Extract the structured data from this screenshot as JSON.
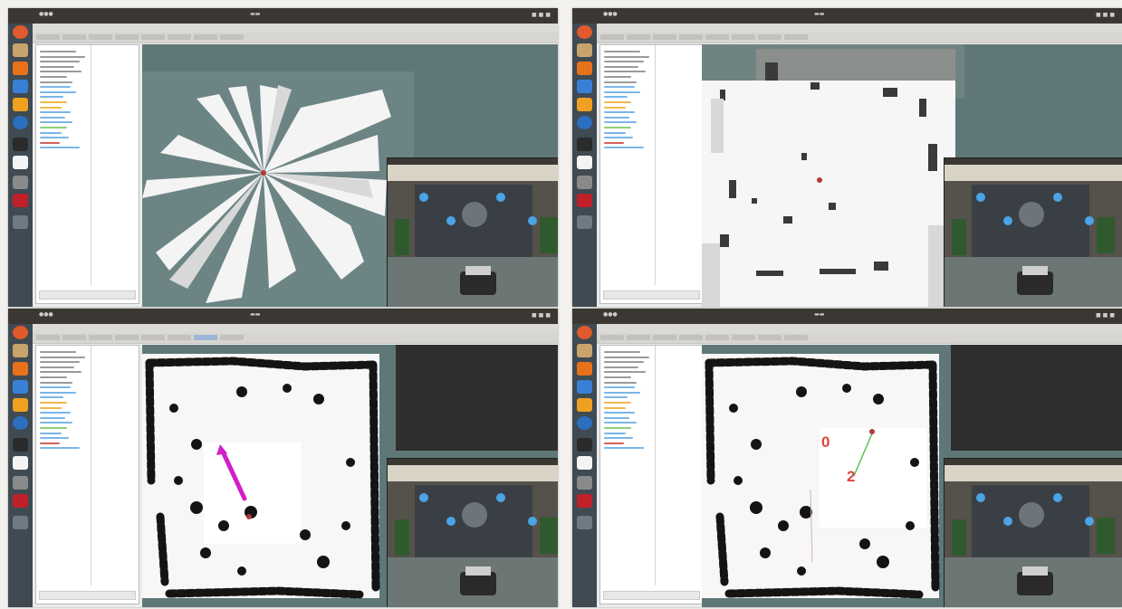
{
  "screenshots": [
    {
      "id": "top-left",
      "view": "laser-scan map (early mapping)",
      "camera": true
    },
    {
      "id": "top-right",
      "view": "point-cloud map",
      "camera": true
    },
    {
      "id": "bottom-left",
      "view": "costmap with goal arrow",
      "camera": true
    },
    {
      "id": "bottom-right",
      "view": "costmap with waypoints",
      "camera": true
    }
  ],
  "waypoint_labels": {
    "first": "0",
    "second": "2"
  },
  "colors": {
    "topbar": "#3b3834",
    "launcher": "#3f4a52",
    "rviz_background": "#5f7877",
    "goal_arrow": "#d21ec8",
    "waypoint_label": "#e0453f",
    "map_free": "#f7f7f7",
    "map_obstacle": "#141414"
  },
  "icons": [
    "ubuntu-dash-icon",
    "files-icon",
    "firefox-icon",
    "terminal-icon",
    "settings-icon",
    "software-icon"
  ]
}
